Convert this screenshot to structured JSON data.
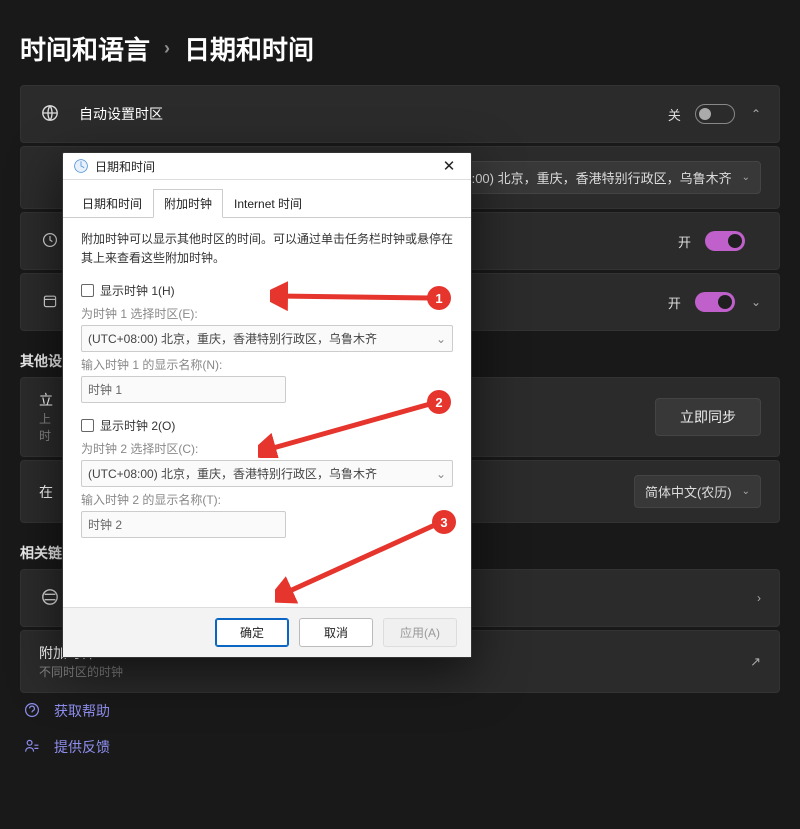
{
  "breadcrumb": {
    "root": "时间和语言",
    "leaf": "日期和时间"
  },
  "rows": {
    "auto_tz": {
      "label": "自动设置时区",
      "state": "关"
    },
    "tz_value": "(UTC+08:00) 北京，重庆，香港特别行政区，乌鲁木齐",
    "row2_state": "开",
    "row3_state": "开",
    "other_header": "其他设",
    "sync": {
      "left1": "立",
      "left2": "上",
      "left3": "时",
      "button": "立即同步"
    },
    "taskbar": {
      "left": "在",
      "value": "简体中文(农历)"
    },
    "related_header": "相关链",
    "additional": {
      "title": "附加时钟",
      "sub": "不同时区的时钟"
    },
    "help": "获取帮助",
    "feedback": "提供反馈"
  },
  "dialog": {
    "title": "日期和时间",
    "tabs": {
      "t1": "日期和时间",
      "t2": "附加时钟",
      "t3": "Internet 时间"
    },
    "intro": "附加时钟可以显示其他时区的时间。可以通过单击任务栏时钟或悬停在其上来查看这些附加时钟。",
    "clock1": {
      "check": "显示时钟 1(H)",
      "tz_label": "为时钟 1 选择时区(E):",
      "tz_value": "(UTC+08:00) 北京，重庆，香港特别行政区，乌鲁木齐",
      "name_label": "输入时钟 1 的显示名称(N):",
      "name_value": "时钟 1"
    },
    "clock2": {
      "check": "显示时钟 2(O)",
      "tz_label": "为时钟 2 选择时区(C):",
      "tz_value": "(UTC+08:00) 北京，重庆，香港特别行政区，乌鲁木齐",
      "name_label": "输入时钟 2 的显示名称(T):",
      "name_value": "时钟 2"
    },
    "buttons": {
      "ok": "确定",
      "cancel": "取消",
      "apply": "应用(A)"
    }
  },
  "badges": {
    "b1": "1",
    "b2": "2",
    "b3": "3"
  }
}
